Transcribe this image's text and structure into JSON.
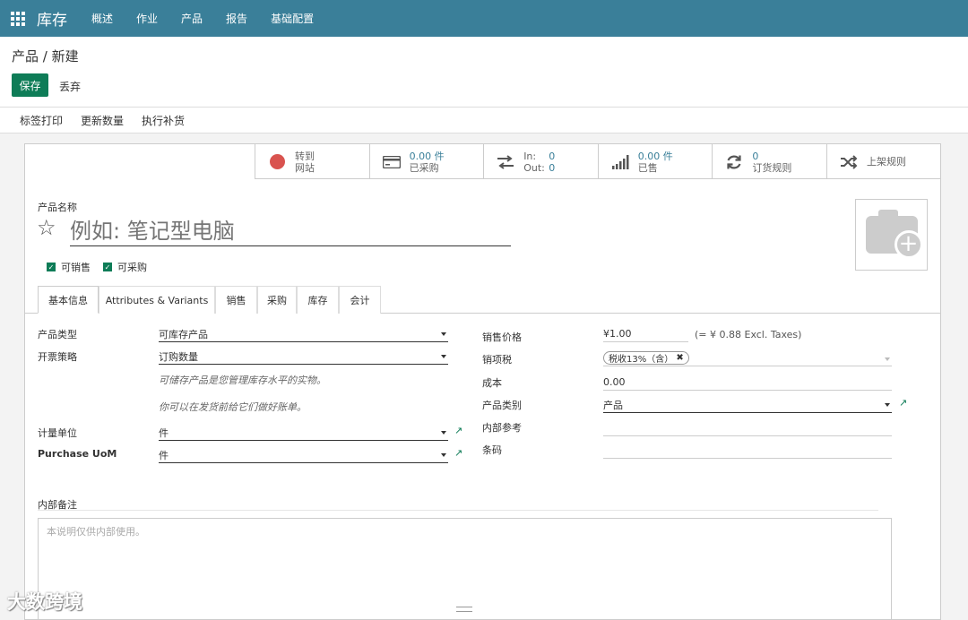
{
  "navbar": {
    "brand": "库存",
    "items": [
      "概述",
      "作业",
      "产品",
      "报告",
      "基础配置"
    ]
  },
  "breadcrumb": {
    "parent": "产品",
    "separator": " / ",
    "current": "新建"
  },
  "buttons": {
    "save": "保存",
    "discard": "丢弃"
  },
  "statusbar": {
    "items": [
      "标签打印",
      "更新数量",
      "执行补货"
    ]
  },
  "smart_buttons": {
    "website": {
      "line1": "转到",
      "line2": "网站"
    },
    "purchased": {
      "value": "0.00 件",
      "label": "已采购"
    },
    "inout": {
      "in_label": "In:",
      "in_value": "0",
      "out_label": "Out:",
      "out_value": "0"
    },
    "sold": {
      "value": "0.00 件",
      "label": "已售"
    },
    "reorder": {
      "value": "0",
      "label": "订货规则"
    },
    "putaway": {
      "label": "上架规则"
    }
  },
  "product": {
    "name_label": "产品名称",
    "name_placeholder": "例如: 笔记型电脑",
    "can_sell": "可销售",
    "can_purchase": "可采购"
  },
  "tabs": [
    "基本信息",
    "Attributes & Variants",
    "销售",
    "采购",
    "库存",
    "会计"
  ],
  "left_fields": {
    "type_label": "产品类型",
    "type_value": "可库存产品",
    "invoice_label": "开票策略",
    "invoice_value": "订购数量",
    "help1": "可储存产品是您管理库存水平的实物。",
    "help2": "你可以在发货前给它们做好账单。",
    "uom_label": "计量单位",
    "uom_value": "件",
    "puom_label": "Purchase UoM",
    "puom_value": "件"
  },
  "right_fields": {
    "price_label": "销售价格",
    "price_value": "¥1.00",
    "price_excl": "(= ¥ 0.88 Excl. Taxes)",
    "tax_label": "销项税",
    "tax_tag": "税收13%（含）",
    "cost_label": "成本",
    "cost_value": "0.00",
    "category_label": "产品类别",
    "category_value": "产品",
    "ref_label": "内部参考",
    "barcode_label": "条码"
  },
  "notes": {
    "label": "内部备注",
    "placeholder": "本说明仅供内部使用。"
  },
  "watermark": "大数跨境"
}
